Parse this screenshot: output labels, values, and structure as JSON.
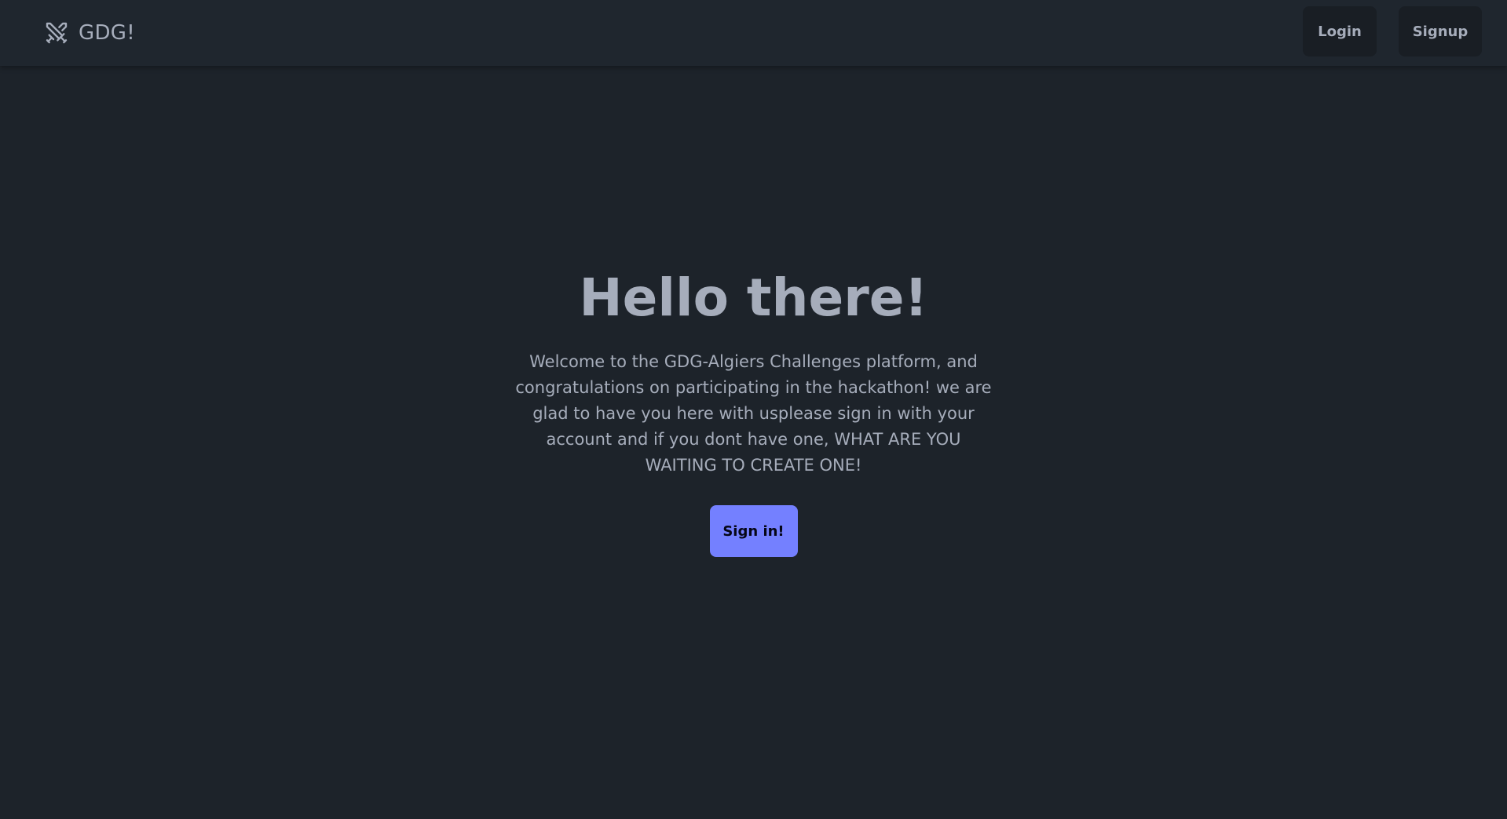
{
  "navbar": {
    "brand_text": "GDG!",
    "brand_icon": "crossed-swords-icon",
    "login_label": "Login",
    "signup_label": "Signup"
  },
  "hero": {
    "title": "Hello there!",
    "text": "Welcome to the GDG-Algiers Challenges platform, and congratulations on participating in the hackathon! we are glad to have you here with usplease sign in with your account and if you dont have one, WHAT ARE YOU WAITING TO CREATE ONE!",
    "cta_label": "Sign in!"
  },
  "colors": {
    "background": "#1d232a",
    "navbar": "#1f262e",
    "button": "#191e24",
    "primary": "#7480ff",
    "text": "#a6adbb"
  }
}
